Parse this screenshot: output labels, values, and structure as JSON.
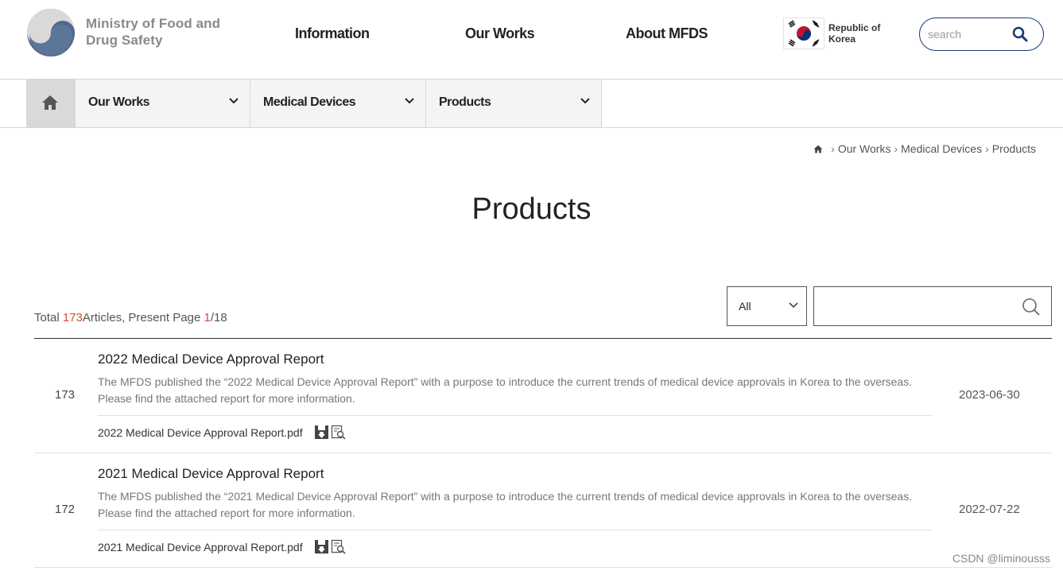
{
  "header": {
    "logo_text": "Ministry of Food and Drug Safety",
    "nav": [
      "Information",
      "Our Works",
      "About MFDS"
    ],
    "country_label": "Republic of Korea",
    "search_placeholder": "search"
  },
  "subnav": {
    "items": [
      {
        "label": "Our Works"
      },
      {
        "label": "Medical Devices"
      },
      {
        "label": "Products"
      }
    ]
  },
  "breadcrumb": [
    "Our Works",
    "Medical Devices",
    "Products"
  ],
  "page_title": "Products",
  "list_info": {
    "prefix": "Total ",
    "total": "173",
    "middle": "Articles, Present Page ",
    "page": "1",
    "suffix": "/18"
  },
  "filter": {
    "selected": "All"
  },
  "articles": [
    {
      "no": "173",
      "title": "2022 Medical Device Approval Report",
      "desc": "The MFDS published the “2022 Medical Device Approval Report” with a purpose to introduce the current trends of medical device approvals in Korea to the overseas. Please find the attached report for more information.",
      "file": "2022 Medical Device Approval Report.pdf",
      "date": "2023-06-30"
    },
    {
      "no": "172",
      "title": "2021 Medical Device Approval Report",
      "desc": "The MFDS published the “2021 Medical Device Approval Report” with a purpose to introduce the current trends of medical device approvals in Korea to the overseas. Please find the attached report for more information.",
      "file": "2021 Medical Device Approval Report.pdf",
      "date": "2022-07-22"
    }
  ],
  "watermark": "CSDN @liminousss",
  "colors": {
    "accent": "#d4512b",
    "search_border": "#1a3a7a",
    "home_bg": "#d9d9d9"
  }
}
